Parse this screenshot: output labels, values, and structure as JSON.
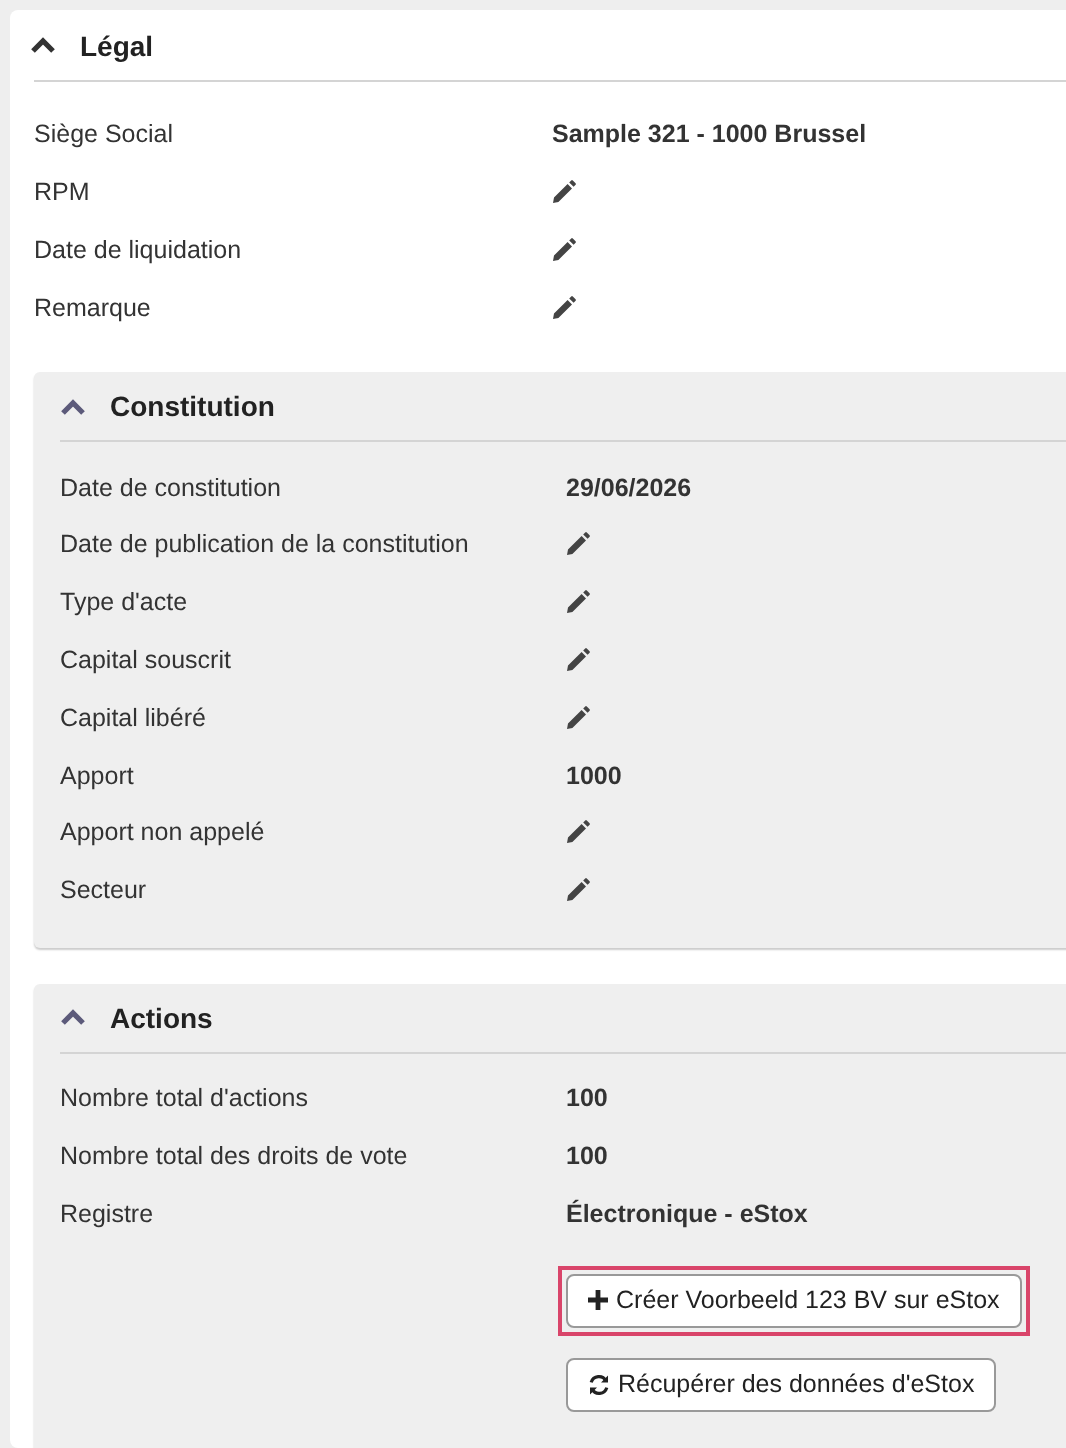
{
  "section": {
    "title": "Légal",
    "expanded": true,
    "rows": [
      {
        "label": "Siège Social",
        "kind": "text",
        "value": "Sample 321 - 1000 Brussel"
      },
      {
        "label": "RPM",
        "kind": "edit"
      },
      {
        "label": "Date de liquidation",
        "kind": "edit"
      },
      {
        "label": "Remarque",
        "kind": "edit"
      }
    ],
    "subsections": [
      {
        "title": "Constitution",
        "expanded": true,
        "rows": [
          {
            "label": "Date de constitution",
            "kind": "text",
            "value": "29/06/2026"
          },
          {
            "label": "Date de publication de la constitution",
            "kind": "edit"
          },
          {
            "label": "Type d'acte",
            "kind": "edit"
          },
          {
            "label": "Capital souscrit",
            "kind": "edit"
          },
          {
            "label": "Capital libéré",
            "kind": "edit"
          },
          {
            "label": "Apport",
            "kind": "text",
            "value": "1000"
          },
          {
            "label": "Apport non appelé",
            "kind": "edit"
          },
          {
            "label": "Secteur",
            "kind": "edit"
          }
        ]
      },
      {
        "title": "Actions",
        "expanded": true,
        "rows": [
          {
            "label": "Nombre total d'actions",
            "kind": "text",
            "value": "100"
          },
          {
            "label": "Nombre total des droits de vote",
            "kind": "text",
            "value": "100"
          },
          {
            "label": "Registre",
            "kind": "text",
            "value": "Électronique - eStox"
          }
        ],
        "buttons": [
          {
            "label": "Créer Voorbeeld 123 BV sur eStox",
            "kind": "plus",
            "highlighted": true
          },
          {
            "label": "Récupérer des données d'eStox",
            "kind": "refresh",
            "highlighted": false
          }
        ]
      }
    ]
  }
}
